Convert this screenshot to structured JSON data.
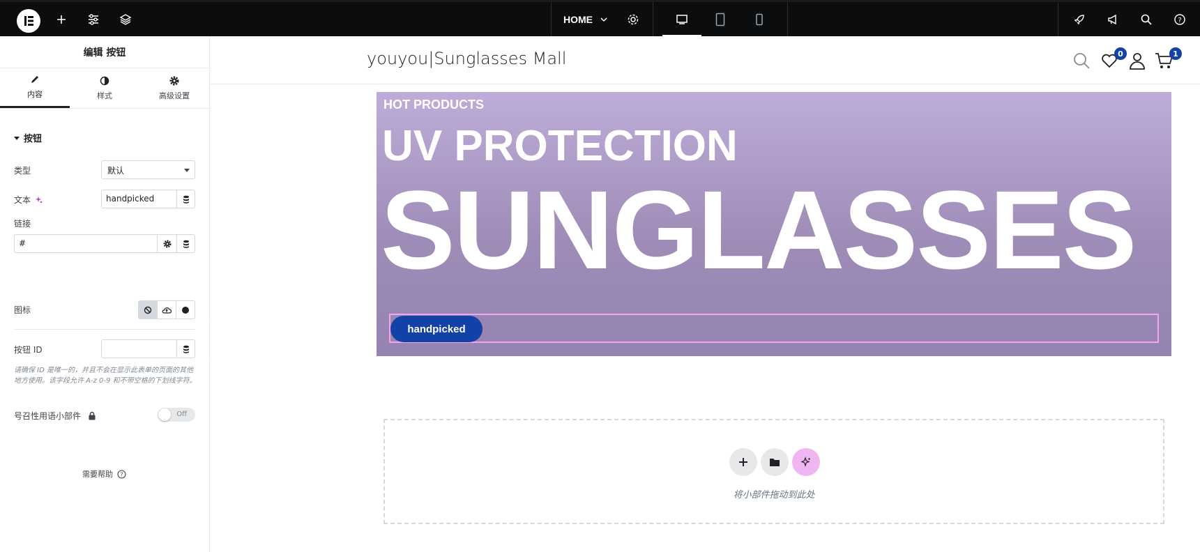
{
  "topbar": {
    "page_selector": "HOME"
  },
  "panel": {
    "title": "编辑 按钮",
    "tabs": [
      {
        "label": "内容",
        "icon": "pencil-icon",
        "active": true
      },
      {
        "label": "样式",
        "icon": "half-circle-icon",
        "active": false
      },
      {
        "label": "高级设置",
        "icon": "gear-icon",
        "active": false
      }
    ],
    "section": "按钮",
    "type_label": "类型",
    "type_value": "默认",
    "text_label": "文本",
    "text_value": "handpicked",
    "link_label": "链接",
    "link_value": "#",
    "icon_label": "图标",
    "button_id_label": "按钮 ID",
    "button_id_value": "",
    "hint": "请确保 ID 是唯一的，并且不会在显示此表单的页面的其他地方使用。该字段允许 A-z 0-9 和不带空格的下划线字符。",
    "cta_widget_label": "号召性用语小部件",
    "toggle_text": "Off",
    "help_label": "需要帮助"
  },
  "site": {
    "title": "youyou|Sunglasses Mall",
    "wishlist_count": "0",
    "cart_count": "1"
  },
  "hero": {
    "kicker": "HOT PRODUCTS",
    "subtitle": "UV PROTECTION",
    "headline": "SUNGLASSES",
    "button_label": "handpicked",
    "gradient_top": "#bfadd9",
    "gradient_bottom": "#9483b0",
    "button_color": "#1242a8"
  },
  "dropzone": {
    "text": "将小部件拖动到此处"
  }
}
